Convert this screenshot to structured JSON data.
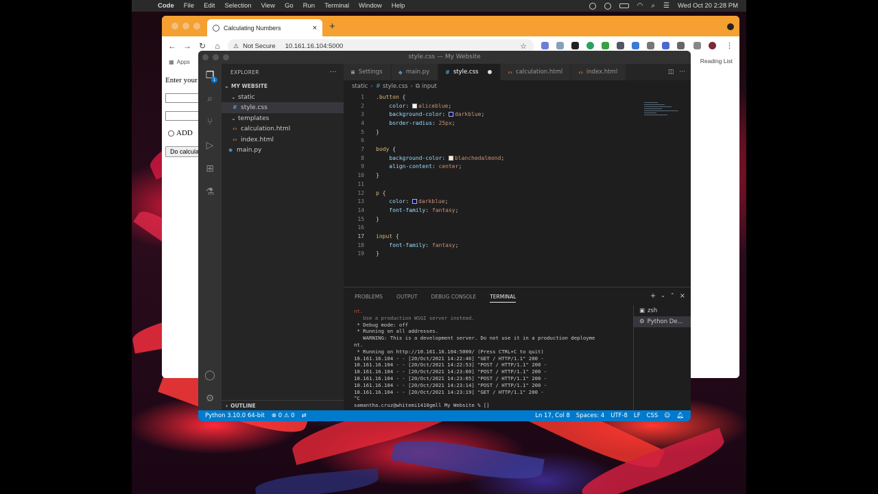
{
  "menubar": {
    "app": "Code",
    "menus": [
      "File",
      "Edit",
      "Selection",
      "View",
      "Go",
      "Run",
      "Terminal",
      "Window",
      "Help"
    ],
    "datetime": "Wed Oct 20  2:28 PM"
  },
  "browser": {
    "tab_title": "Calculating Numbers",
    "security": "Not Secure",
    "url": "10.161.16.104:5000",
    "bookmarks_apps": "Apps",
    "reading_list": "Reading List",
    "page": {
      "label": "Enter your",
      "radio_label": "ADD",
      "button_label": "Do calcula"
    }
  },
  "vscode": {
    "window_title": "style.css — My Website",
    "explorer": {
      "header": "EXPLORER",
      "project": "MY WEBSITE",
      "items": [
        {
          "label": "static",
          "type": "folder"
        },
        {
          "label": "style.css",
          "type": "css"
        },
        {
          "label": "templates",
          "type": "folder"
        },
        {
          "label": "calculation.html",
          "type": "html"
        },
        {
          "label": "index.html",
          "type": "html"
        },
        {
          "label": "main.py",
          "type": "py"
        }
      ],
      "outline": "OUTLINE"
    },
    "tabs": [
      {
        "label": "Settings",
        "icon": "settings-icon"
      },
      {
        "label": "main.py",
        "icon": "python-icon"
      },
      {
        "label": "style.css",
        "icon": "css-icon",
        "active": true,
        "modified": true
      },
      {
        "label": "calculation.html",
        "icon": "html-icon"
      },
      {
        "label": "index.html",
        "icon": "html-icon"
      }
    ],
    "breadcrumb": [
      "static",
      "style.css",
      "input"
    ],
    "code_lines": [
      {
        "n": "1",
        "text": ".button {"
      },
      {
        "n": "2",
        "text": "    color: aliceblue;"
      },
      {
        "n": "3",
        "text": "    background-color: darkblue;"
      },
      {
        "n": "4",
        "text": "    border-radius: 25px;"
      },
      {
        "n": "5",
        "text": "}"
      },
      {
        "n": "6",
        "text": ""
      },
      {
        "n": "7",
        "text": "body {"
      },
      {
        "n": "8",
        "text": "    background-color: blanchedalmond;"
      },
      {
        "n": "9",
        "text": "    align-content: center;"
      },
      {
        "n": "10",
        "text": "}"
      },
      {
        "n": "11",
        "text": ""
      },
      {
        "n": "12",
        "text": "p {"
      },
      {
        "n": "13",
        "text": "    color: darkblue;"
      },
      {
        "n": "14",
        "text": "    font-family: fantasy;"
      },
      {
        "n": "15",
        "text": "}"
      },
      {
        "n": "16",
        "text": ""
      },
      {
        "n": "17",
        "text": "input {"
      },
      {
        "n": "18",
        "text": "    font-family: fantasy;"
      },
      {
        "n": "19",
        "text": "}"
      }
    ],
    "panel_tabs": [
      "PROBLEMS",
      "OUTPUT",
      "DEBUG CONSOLE",
      "TERMINAL"
    ],
    "terminal_lines": [
      "nt.",
      "   Use a production WSGI server instead.",
      " * Debug mode: off",
      " * Running on all addresses.",
      "   WARNING: This is a development server. Do not use it in a production deployme",
      "nt.",
      " * Running on http://10.161.16.104:5000/ (Press CTRL+C to quit)",
      "10.161.16.104 - - [20/Oct/2021 14:22:46] \"GET / HTTP/1.1\" 200 -",
      "10.161.16.104 - - [20/Oct/2021 14:22:53] \"POST / HTTP/1.1\" 200 -",
      "10.161.16.104 - - [20/Oct/2021 14:23:00] \"POST / HTTP/1.1\" 200 -",
      "10.161.16.104 - - [20/Oct/2021 14:23:05] \"POST / HTTP/1.1\" 200 -",
      "10.161.16.104 - - [20/Oct/2021 14:23:14] \"POST / HTTP/1.1\" 200 -",
      "10.161.16.104 - - [20/Oct/2021 14:23:19] \"GET / HTTP/1.1\" 200 -",
      "^C",
      "samantha.cruz@whitemi1410gmll My Website % []"
    ],
    "terminals": [
      "zsh",
      "Python De..."
    ],
    "status": {
      "python": "Python 3.10.0 64-bit",
      "problems": "⊗ 0 ⚠ 0",
      "position": "Ln 17, Col 8",
      "spaces": "Spaces: 4",
      "encoding": "UTF-8",
      "eol": "LF",
      "language": "CSS"
    }
  },
  "colors": {
    "chrome_tabbar": "#f5a030",
    "vscode_status": "#007acc",
    "css_icon": "#519aba",
    "html_icon": "#e37933",
    "py_icon": "#4b8bbe"
  }
}
